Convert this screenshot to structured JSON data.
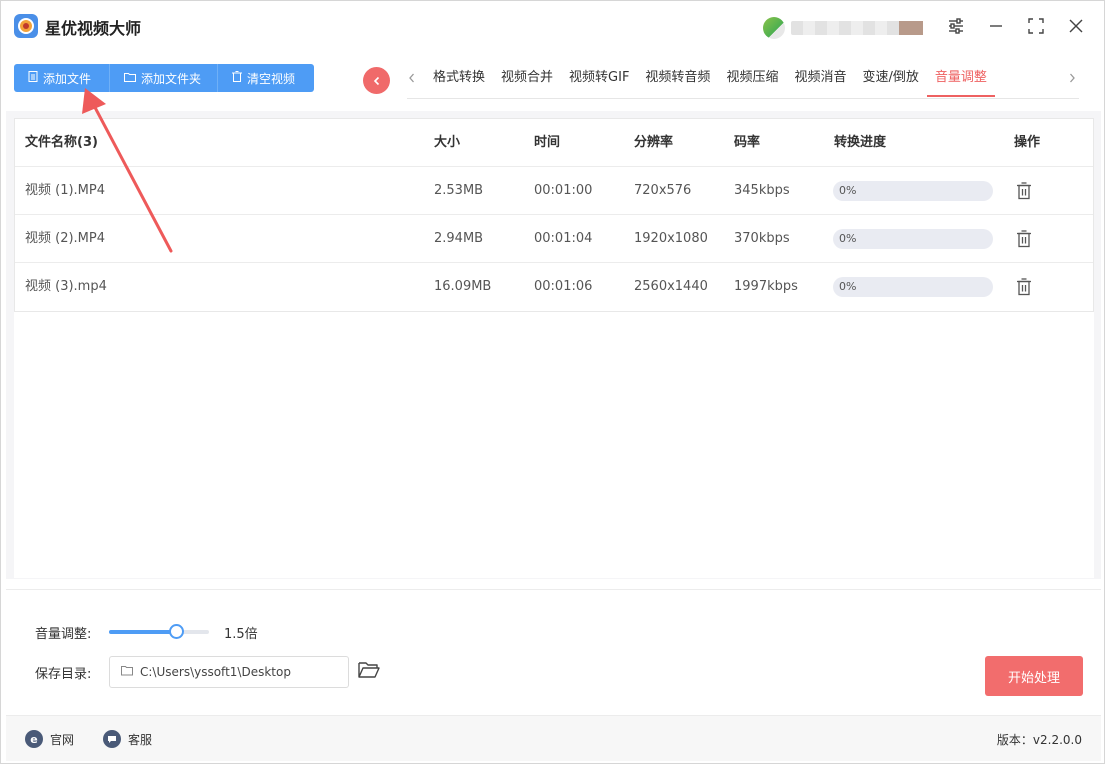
{
  "app": {
    "title": "星优视频大师"
  },
  "window_controls": {
    "settings_icon": "sliders-icon",
    "minimize": "—",
    "maximize": "⛶",
    "close": "✕"
  },
  "toolbar": {
    "add_file": "添加文件",
    "add_folder": "添加文件夹",
    "clear": "清空视频"
  },
  "tabs": {
    "back_icon": "chevron-left-icon",
    "items": [
      "格式转换",
      "视频合并",
      "视频转GIF",
      "视频转音频",
      "视频压缩",
      "视频消音",
      "变速/倒放",
      "音量调整"
    ],
    "active_index": 7
  },
  "table": {
    "headers": {
      "name": "文件名称(3)",
      "size": "大小",
      "time": "时间",
      "resolution": "分辨率",
      "bitrate": "码率",
      "progress": "转换进度",
      "action": "操作"
    },
    "rows": [
      {
        "name": "视频 (1).MP4",
        "size": "2.53MB",
        "time": "00:01:00",
        "resolution": "720x576",
        "bitrate": "345kbps",
        "progress": "0%",
        "progress_value": 0
      },
      {
        "name": "视频 (2).MP4",
        "size": "2.94MB",
        "time": "00:01:04",
        "resolution": "1920x1080",
        "bitrate": "370kbps",
        "progress": "0%",
        "progress_value": 0
      },
      {
        "name": "视频 (3).mp4",
        "size": "16.09MB",
        "time": "00:01:06",
        "resolution": "2560x1440",
        "bitrate": "1997kbps",
        "progress": "0%",
        "progress_value": 0
      }
    ]
  },
  "settings": {
    "volume_label": "音量调整:",
    "volume_value": "1.5倍",
    "volume_slider_fraction": 0.67,
    "save_label": "保存目录:",
    "save_path": "C:\\Users\\yssoft1\\Desktop",
    "start_button": "开始处理"
  },
  "footer": {
    "website": "官网",
    "support": "客服",
    "version": "版本：v2.2.0.0"
  },
  "colors": {
    "accent_blue": "#4e9cf5",
    "accent_red": "#ee6161",
    "start_red": "#f26d6d"
  }
}
